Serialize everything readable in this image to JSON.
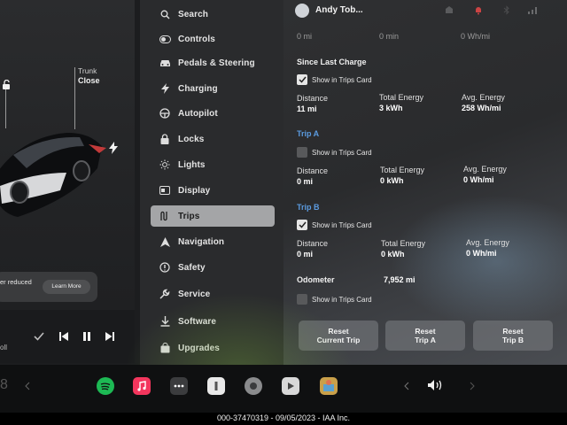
{
  "car": {
    "trunk_title": "Trunk",
    "trunk_state": "Close",
    "notice_text": "er reduced",
    "learn_more": "Learn More"
  },
  "media": {
    "artist_partial": "oll"
  },
  "sidebar": {
    "items": [
      {
        "label": "Search",
        "icon": "search-icon"
      },
      {
        "label": "Controls",
        "icon": "toggle-icon"
      },
      {
        "label": "Pedals & Steering",
        "icon": "car-icon"
      },
      {
        "label": "Charging",
        "icon": "bolt-icon"
      },
      {
        "label": "Autopilot",
        "icon": "steering-wheel-icon"
      },
      {
        "label": "Locks",
        "icon": "lock-icon"
      },
      {
        "label": "Lights",
        "icon": "sun-icon"
      },
      {
        "label": "Display",
        "icon": "display-icon"
      },
      {
        "label": "Trips",
        "icon": "trips-icon",
        "active": true
      },
      {
        "label": "Navigation",
        "icon": "navigation-icon"
      },
      {
        "label": "Safety",
        "icon": "safety-icon"
      },
      {
        "label": "Service",
        "icon": "wrench-icon"
      },
      {
        "label": "Software",
        "icon": "download-icon"
      },
      {
        "label": "Upgrades",
        "icon": "bag-icon"
      }
    ]
  },
  "header": {
    "user_name": "Andy Tob...",
    "lte": "LTE"
  },
  "trips": {
    "cut_row": {
      "distance": "0 mi",
      "duration": "0 min",
      "efficiency": "0 Wh/mi"
    },
    "since_last_charge": {
      "title": "Since Last Charge",
      "show_label": "Show in Trips Card",
      "checked": true,
      "distance_label": "Distance",
      "distance": "11 mi",
      "energy_label": "Total Energy",
      "energy": "3 kWh",
      "avg_label": "Avg. Energy",
      "avg": "258 Wh/mi"
    },
    "trip_a": {
      "title": "Trip A",
      "show_label": "Show in Trips Card",
      "checked": false,
      "distance_label": "Distance",
      "distance": "0 mi",
      "energy_label": "Total Energy",
      "energy": "0 kWh",
      "avg_label": "Avg. Energy",
      "avg": "0 Wh/mi"
    },
    "trip_b": {
      "title": "Trip B",
      "show_label": "Show in Trips Card",
      "checked": true,
      "distance_label": "Distance",
      "distance": "0 mi",
      "energy_label": "Total Energy",
      "energy": "0 kWh",
      "avg_label": "Avg. Energy",
      "avg": "0 Wh/mi"
    },
    "odometer": {
      "label": "Odometer",
      "value": "7,952 mi",
      "show_label": "Show in Trips Card",
      "checked": false
    },
    "buttons": {
      "reset_current_l1": "Reset",
      "reset_current_l2": "Current Trip",
      "reset_a_l1": "Reset",
      "reset_a_l2": "Trip A",
      "reset_b_l1": "Reset",
      "reset_b_l2": "Trip B"
    }
  },
  "taskbar": {
    "temp_partial": "8"
  },
  "footer": {
    "text": "000-37470319 - 09/05/2023 - IAA Inc."
  },
  "colors": {
    "accent_blue": "#5b9be0",
    "active_nav_bg": "#a4a5a7",
    "spotify_green": "#1db954",
    "music_pink": "#f3365d"
  }
}
